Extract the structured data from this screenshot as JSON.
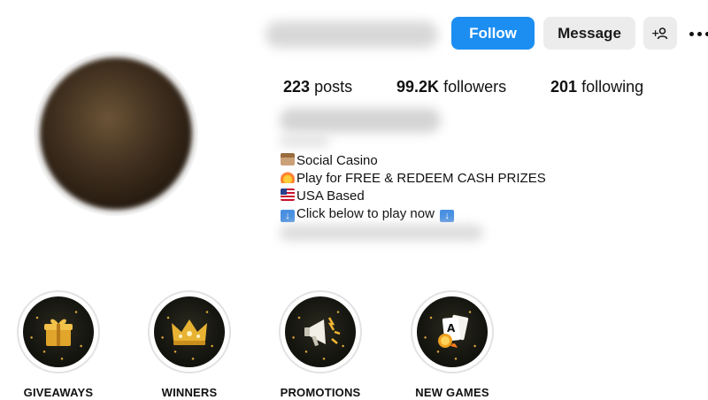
{
  "profile": {
    "actions": {
      "follow_label": "Follow",
      "message_label": "Message",
      "add_user_label": "+♀"
    },
    "stats": [
      {
        "count": "223",
        "label": "posts"
      },
      {
        "count": "99.2K",
        "label": "followers"
      },
      {
        "count": "201",
        "label": "following"
      }
    ],
    "bio": [
      {
        "emoji": "bank-icon",
        "text": "Social Casino"
      },
      {
        "emoji": "fire-icon",
        "text": "Play for FREE & REDEEM CASH PRIZES"
      },
      {
        "emoji": "us-flag-icon",
        "text": "USA Based"
      },
      {
        "emoji": "down-arrow-icon",
        "text": "Click below to play now",
        "trailing_emoji": "down-arrow-icon"
      }
    ]
  },
  "highlights": [
    {
      "label": "GIVEAWAYS",
      "icon": "gift-box-icon"
    },
    {
      "label": "WINNERS",
      "icon": "crown-icon"
    },
    {
      "label": "PROMOTIONS",
      "icon": "megaphone-icon"
    },
    {
      "label": "NEW GAMES",
      "icon": "playing-cards-icon"
    }
  ],
  "colors": {
    "follow_button": "#1c8ef2",
    "secondary_button": "#ececec",
    "highlight_background": "#151510",
    "highlight_accent": "#d9a53a"
  }
}
